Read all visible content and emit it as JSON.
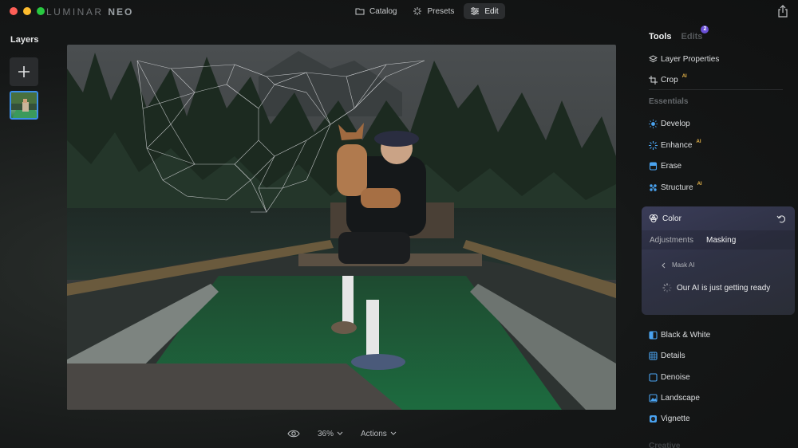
{
  "app": {
    "brand_main": "LUMINAR",
    "brand_sub": "NEO"
  },
  "topnav": {
    "items": [
      {
        "label": "Catalog",
        "icon": "folder-icon"
      },
      {
        "label": "Presets",
        "icon": "sparkle-icon"
      },
      {
        "label": "Edit",
        "icon": "sliders-icon",
        "active": true
      }
    ]
  },
  "layers": {
    "title": "Layers"
  },
  "bottombar": {
    "zoom": "36%",
    "actions": "Actions"
  },
  "panel": {
    "tabs": [
      {
        "label": "Tools",
        "active": true
      },
      {
        "label": "Edits",
        "badge": "2"
      }
    ],
    "top_tools": [
      {
        "label": "Layer Properties",
        "icon": "layers-icon"
      },
      {
        "label": "Crop",
        "icon": "crop-icon",
        "ai": "AI"
      }
    ],
    "essentials_label": "Essentials",
    "essentials": [
      {
        "label": "Develop",
        "icon": "sun-icon",
        "color": "#4aa3f0"
      },
      {
        "label": "Enhance",
        "icon": "enhance-icon",
        "ai": "AI",
        "color": "#4aa3f0"
      },
      {
        "label": "Erase",
        "icon": "eraser-icon",
        "color": "#4aa3f0"
      },
      {
        "label": "Structure",
        "icon": "structure-icon",
        "ai": "AI",
        "color": "#4aa3f0"
      }
    ],
    "color_card": {
      "title": "Color",
      "subtabs": [
        "Adjustments",
        "Masking"
      ],
      "active_subtab": "Masking",
      "mask_ai": "Mask AI",
      "status": "Our AI is just getting ready"
    },
    "more_tools": [
      {
        "label": "Black & White",
        "icon": "bw-icon"
      },
      {
        "label": "Details",
        "icon": "details-icon"
      },
      {
        "label": "Denoise",
        "icon": "denoise-icon"
      },
      {
        "label": "Landscape",
        "icon": "landscape-icon"
      },
      {
        "label": "Vignette",
        "icon": "vignette-icon"
      }
    ],
    "creative_label": "Creative",
    "accent": "#4aa3f0",
    "ai_color": "#e8b64a",
    "badge_color": "#6a4fd6"
  }
}
